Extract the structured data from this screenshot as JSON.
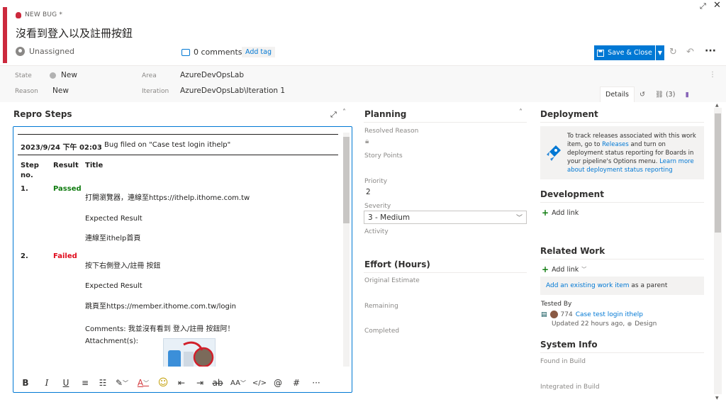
{
  "window": {
    "expand_icon": "expand-icon",
    "close_icon": "close-icon"
  },
  "header": {
    "type_label": "NEW BUG *",
    "title": "沒看到登入以及註冊按鈕",
    "assigned_to": "Unassigned",
    "comments": "0 comments",
    "add_tag": "Add tag",
    "save_close": "Save & Close",
    "more": "···"
  },
  "fields": {
    "state_label": "State",
    "state_value": "New",
    "reason_label": "Reason",
    "reason_value": "New",
    "area_label": "Area",
    "area_value": "AzureDevOpsLab",
    "iteration_label": "Iteration",
    "iteration_value": "AzureDevOpsLab\\Iteration 1"
  },
  "tabs": {
    "details": "Details",
    "links": "(3)"
  },
  "repro": {
    "heading": "Repro Steps",
    "timestamp": "2023/9/24 下午 02:03",
    "filed_on": "Bug filed on \"Case test login ithelp\"",
    "col_step": "Step",
    "col_step2": "no.",
    "col_result": "Result",
    "col_title": "Title",
    "steps": [
      {
        "no": "1.",
        "result": "Passed",
        "action": "打開瀏覽器，連線至https://ithelp.ithome.com.tw",
        "expected_label": "Expected Result",
        "expected": "連線至ithelp首頁"
      },
      {
        "no": "2.",
        "result": "Failed",
        "action": "按下右側登入/註冊 按鈕",
        "expected_label": "Expected Result",
        "expected": "跳頁至https://member.ithome.com.tw/login",
        "comments": "Comments: 我並沒有看到 登入/註冊 按鈕阿！",
        "attachments": "Attachment(s):"
      }
    ]
  },
  "toolbar": {
    "bold": "B",
    "italic": "I",
    "underline": "U",
    "align": "≡",
    "list": "☷",
    "highlight": "✎",
    "font_color": "A",
    "emoji": "☺",
    "outdent": "⇤",
    "indent": "⇥",
    "strike": "ab",
    "size": "AA",
    "code": "</>",
    "mention": "@",
    "hash": "#",
    "more": "···"
  },
  "planning": {
    "heading": "Planning",
    "resolved_reason": "Resolved Reason",
    "story_points": "Story Points",
    "priority_label": "Priority",
    "priority_value": "2",
    "severity_label": "Severity",
    "severity_value": "3 - Medium",
    "activity": "Activity"
  },
  "effort": {
    "heading": "Effort (Hours)",
    "original_estimate": "Original Estimate",
    "remaining": "Remaining",
    "completed": "Completed"
  },
  "deployment": {
    "heading": "Deployment",
    "text1": "To track releases associated with this work item, go to ",
    "releases_link": "Releases",
    "text2": " and turn on deployment status reporting for Boards in your pipeline's Options menu. ",
    "learn_link": "Learn more about deployment status reporting"
  },
  "development": {
    "heading": "Development",
    "add_link": "Add link"
  },
  "related_work": {
    "heading": "Related Work",
    "add_link": "Add link",
    "add_existing": "Add an existing work item",
    "as_parent": " as a parent",
    "tested_by": "Tested By",
    "item_id": "774",
    "item_title": "Case test login ithelp",
    "item_meta": "Updated 22 hours ago,",
    "item_state": "Design"
  },
  "system_info": {
    "heading": "System Info",
    "found_in_build": "Found in Build",
    "integrated_in_build": "Integrated in Build"
  },
  "colors": {
    "accent": "#0078d4",
    "bug_red": "#cc293d",
    "passed": "#107c10",
    "failed": "#e00b1c"
  }
}
